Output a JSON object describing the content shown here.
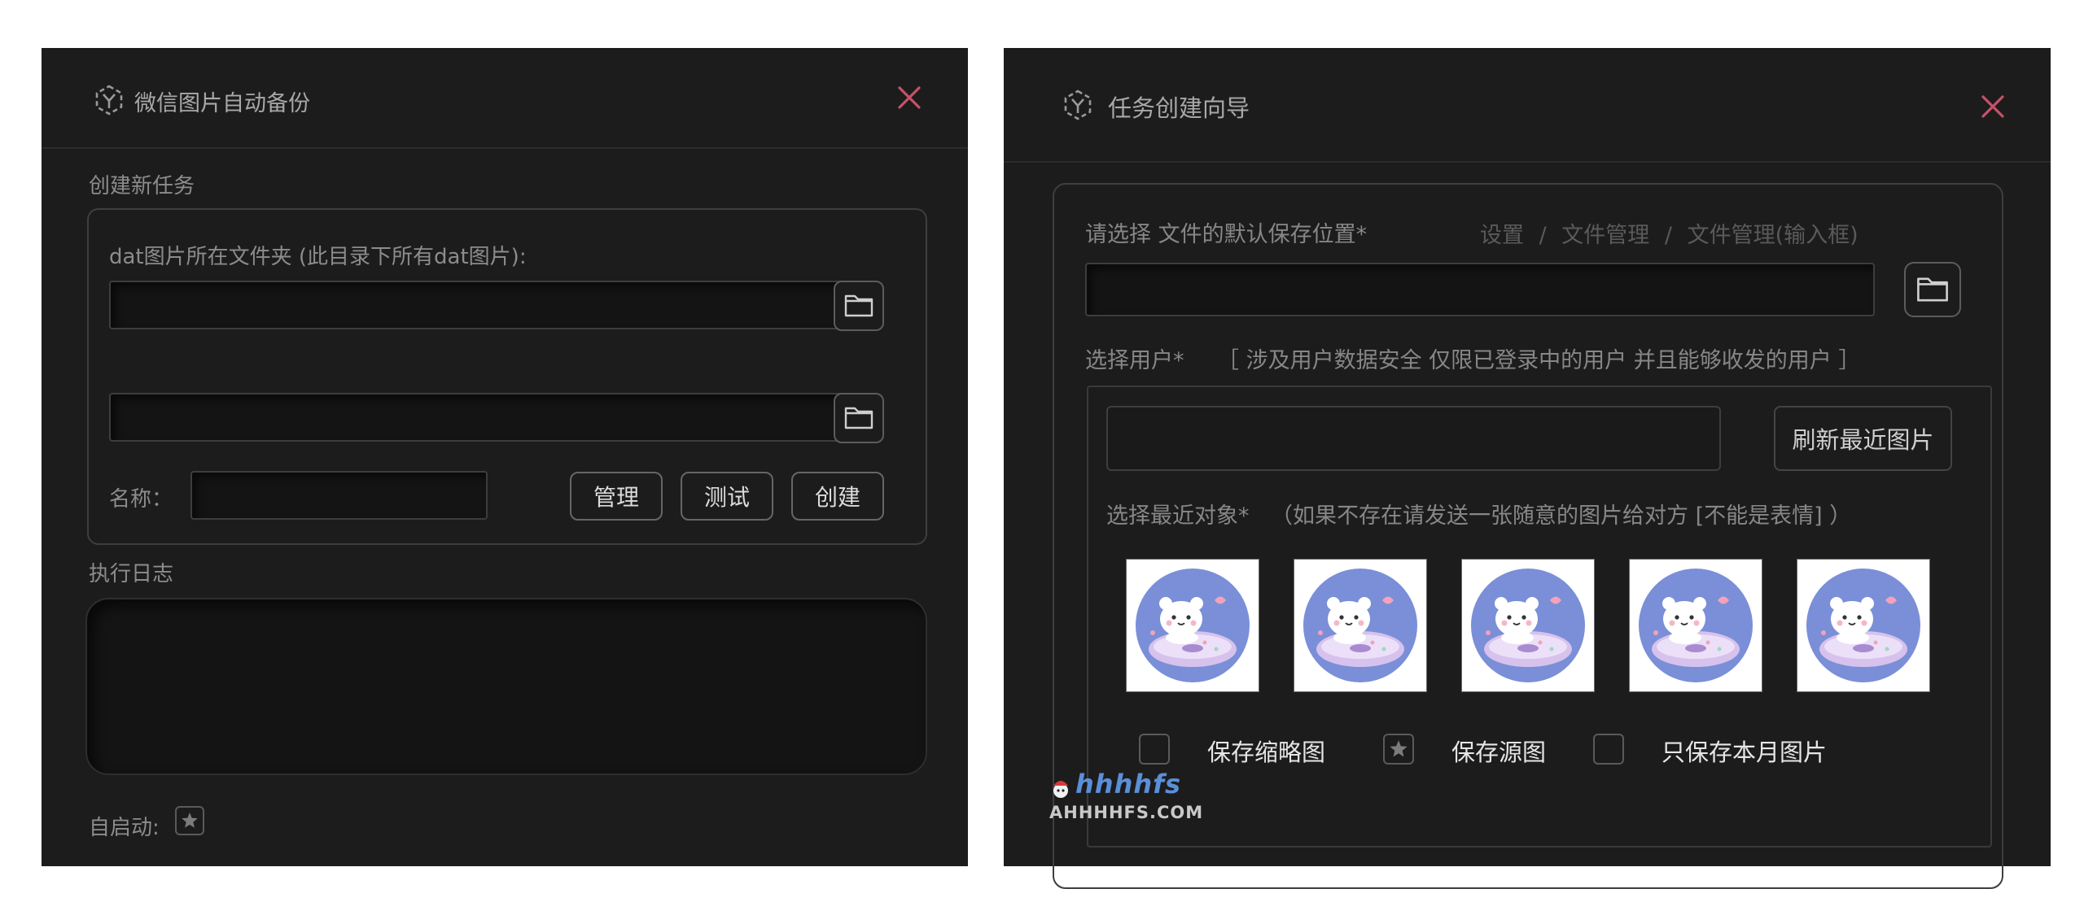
{
  "left_window": {
    "title": "微信图片自动备份",
    "section_create": "创建新任务",
    "dat_label": "dat图片所在文件夹 (此目录下所有dat图片):",
    "dat_folder_value": "",
    "output_folder_value": "",
    "name_label": "名称：",
    "name_value": "",
    "buttons": {
      "manage": "管理",
      "test": "测试",
      "create": "创建"
    },
    "section_log": "执行日志",
    "autostart_label": "自启动:",
    "autostart_checked": true
  },
  "right_window": {
    "title": "任务创建向导",
    "save_location_label": "请选择 文件的默认保存位置*",
    "path_hint": [
      "设置",
      "文件管理",
      "文件管理(输入框)"
    ],
    "path_separator": "/",
    "save_location_value": "",
    "user_label": "选择用户*",
    "user_hint": "［ 涉及用户数据安全   仅限已登录中的用户 并且能够收发的用户 ］",
    "user_value": "",
    "refresh_button": "刷新最近图片",
    "recent_label": "选择最近对象*",
    "recent_hint": "（如果不存在请发送一张随意的图片给对方 [不能是表情] ）",
    "thumbnails": [
      {
        "icon": "bear-donut-avatar"
      },
      {
        "icon": "bear-donut-avatar"
      },
      {
        "icon": "bear-donut-avatar"
      },
      {
        "icon": "bear-donut-avatar"
      },
      {
        "icon": "bear-donut-avatar"
      }
    ],
    "options": [
      {
        "label": "保存缩略图",
        "checked": false
      },
      {
        "label": "保存源图",
        "checked": true
      },
      {
        "label": "只保存本月图片",
        "checked": false
      }
    ]
  },
  "watermark": {
    "script": "hhhhfs",
    "domain": "AHHHHFS.COM"
  },
  "colors": {
    "panel": "#1c1c1c",
    "close": "#c8506a",
    "input_bg": "#141414"
  }
}
